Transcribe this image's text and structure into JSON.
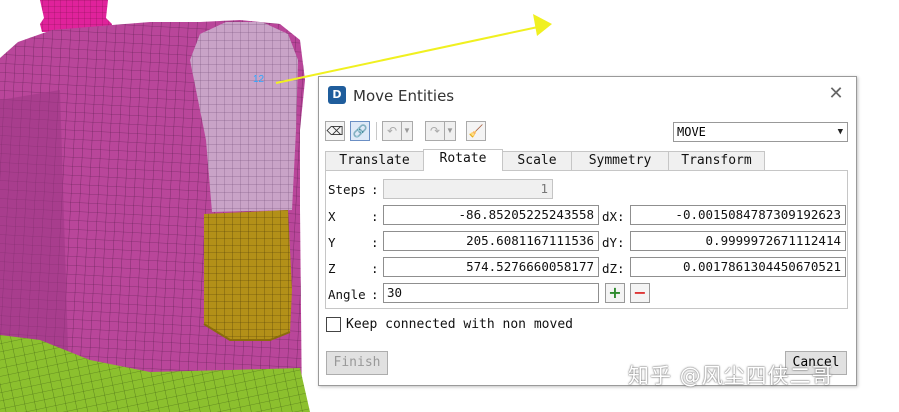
{
  "viewport": {
    "node_label": "12",
    "watermark": "知乎 @风尘四侠二哥",
    "colors": {
      "body_mesh": "#b9469a",
      "arm_mesh": "#c9a3c7",
      "cuff": "#b39018",
      "collar": "#e0229b",
      "pants": "#8cc02e",
      "vector": "#f0f020"
    }
  },
  "dialog": {
    "title": "Move Entities",
    "app_icon": "app-logo-icon",
    "close_glyph": "✕",
    "mode_value": "MOVE",
    "tabs": [
      {
        "label": "Translate",
        "active": false
      },
      {
        "label": "Rotate",
        "active": true
      },
      {
        "label": "Scale",
        "active": false
      },
      {
        "label": "Symmetry",
        "active": false
      },
      {
        "label": "Transform",
        "active": false
      }
    ],
    "steps": {
      "label": "Steps",
      "value": "1"
    },
    "x": {
      "label": "X",
      "value": "-86.85205225243558"
    },
    "y": {
      "label": "Y",
      "value": "205.6081167111536"
    },
    "z": {
      "label": "Z",
      "value": "574.5276660058177"
    },
    "dx": {
      "label": "dX:",
      "value": "-0.0015084787309192623"
    },
    "dy": {
      "label": "dY:",
      "value": "0.9999972671112414"
    },
    "dz": {
      "label": "dZ:",
      "value": "0.0017861304450670521"
    },
    "angle": {
      "label": "Angle",
      "value": "30"
    },
    "plus": "+",
    "minus": "−",
    "keep_connected": {
      "label": "Keep connected with non moved",
      "checked": false
    },
    "finish_label": "Finish",
    "cancel_label": "Cancel"
  }
}
